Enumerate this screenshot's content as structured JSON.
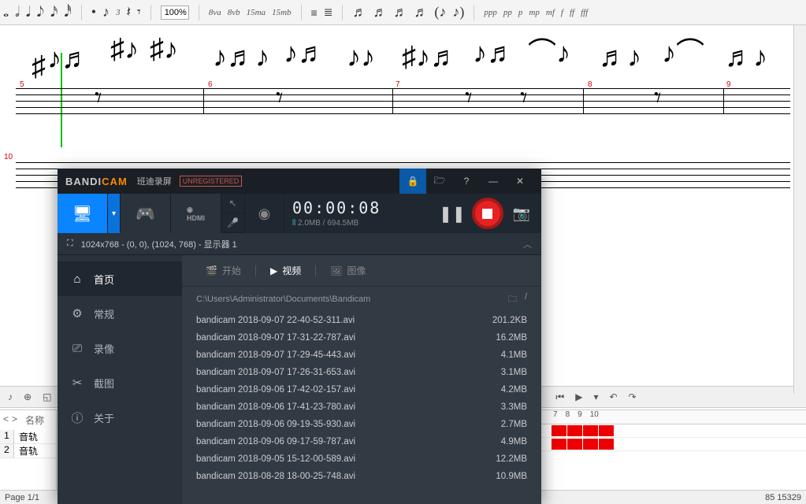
{
  "music_toolbar": {
    "zoom": "100%",
    "items_left": [
      "𝅝",
      "𝅗𝅥",
      "𝅘𝅥",
      "𝅘𝅥𝅮",
      "𝅘𝅥𝅯",
      "𝅘𝅥𝅰"
    ],
    "items_mid": [
      "•",
      "♪",
      "3",
      "𝄽",
      "𝄾"
    ],
    "items_oct": [
      "8va",
      "8vb",
      "15ma",
      "15mb"
    ],
    "items_artic": [
      "♬",
      "♬",
      "♬",
      "♬",
      "(♪",
      "♪)"
    ],
    "items_dyn": [
      "ppp",
      "pp",
      "p",
      "mp",
      "mf",
      "f",
      "ff",
      "fff"
    ]
  },
  "measures": [
    "5",
    "6",
    "7",
    "8",
    "9",
    "10"
  ],
  "status": {
    "page": "Page 1/1",
    "coord": "85 15329"
  },
  "tracks": {
    "nav": [
      "<",
      ">"
    ],
    "label": "名称",
    "rows": [
      "1",
      "2"
    ],
    "rowlabel": "音轨",
    "header_nums": [
      "7",
      "8",
      "9",
      "10"
    ]
  },
  "bandicam": {
    "logo1": "BANDI",
    "logo2": "CAM",
    "subtitle": "班迪录屏",
    "unreg": "UNREGISTERED",
    "timer": "00:00:08",
    "size": "2.0MB / 694.5MB",
    "capture": "1024x768 - (0, 0), (1024, 768) - 显示器 1",
    "sidebar": [
      {
        "icon": "⌂",
        "label": "首页"
      },
      {
        "icon": "⚙",
        "label": "常规"
      },
      {
        "icon": "⎚",
        "label": "录像"
      },
      {
        "icon": "✂",
        "label": "截图"
      },
      {
        "icon": "ⓘ",
        "label": "关于"
      }
    ],
    "tabs": [
      {
        "icon": "🎬",
        "label": "开始"
      },
      {
        "icon": "▶",
        "label": "视频"
      },
      {
        "icon": "🖼",
        "label": "图像"
      }
    ],
    "path": "C:\\Users\\Administrator\\Documents\\Bandicam",
    "files": [
      {
        "name": "bandicam 2018-09-07 22-40-52-311.avi",
        "size": "201.2KB"
      },
      {
        "name": "bandicam 2018-09-07 17-31-22-787.avi",
        "size": "16.2MB"
      },
      {
        "name": "bandicam 2018-09-07 17-29-45-443.avi",
        "size": "4.1MB"
      },
      {
        "name": "bandicam 2018-09-07 17-26-31-653.avi",
        "size": "3.1MB"
      },
      {
        "name": "bandicam 2018-09-06 17-42-02-157.avi",
        "size": "4.2MB"
      },
      {
        "name": "bandicam 2018-09-06 17-41-23-780.avi",
        "size": "3.3MB"
      },
      {
        "name": "bandicam 2018-09-06 09-19-35-930.avi",
        "size": "2.7MB"
      },
      {
        "name": "bandicam 2018-09-06 09-17-59-787.avi",
        "size": "4.9MB"
      },
      {
        "name": "bandicam 2018-09-05 15-12-00-589.avi",
        "size": "12.2MB"
      },
      {
        "name": "bandicam 2018-08-28 18-00-25-748.avi",
        "size": "10.9MB"
      }
    ]
  }
}
